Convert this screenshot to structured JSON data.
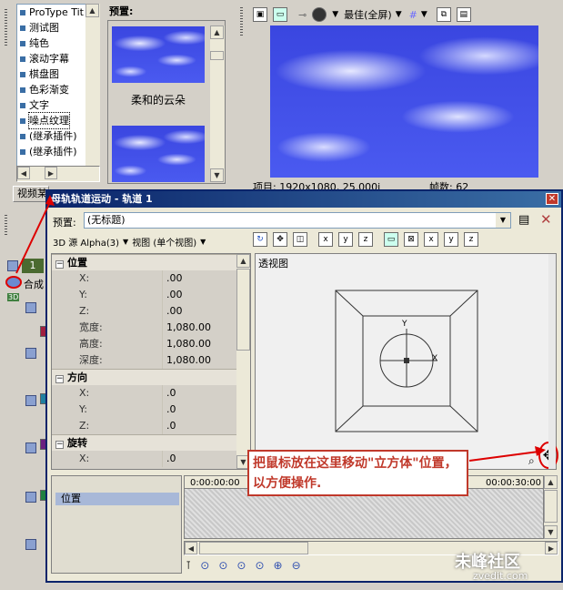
{
  "media_list": {
    "items": [
      "ProType Tit",
      "测试图",
      "纯色",
      "滚动字幕",
      "棋盘图",
      "色彩渐变",
      "文字",
      "噪点纹理",
      "(继承插件)",
      "(继承插件)"
    ],
    "selected_index": 7
  },
  "presets": {
    "label": "预置:",
    "items": [
      "柔和的云朵"
    ]
  },
  "viewer": {
    "quality": "最佳(全屏)",
    "status_left": "项目: 1920x1080, 25.000i",
    "status_right": "帧数: 62"
  },
  "left_tab": "视频某",
  "track": {
    "number": "1",
    "label": "合成",
    "badge": "3D"
  },
  "dialog": {
    "title": "母轨轨道运动 - 轨道 1",
    "preset_label": "预置:",
    "preset_value": "(无标题)",
    "source_mode": "3D 源 Alpha(3)",
    "view_mode": "视图 (单个视图)",
    "groups": {
      "position": "位置",
      "orientation": "方向",
      "rotation": "旋转"
    },
    "position_props": [
      {
        "name": "X:",
        "value": ".00"
      },
      {
        "name": "Y:",
        "value": ".00"
      },
      {
        "name": "Z:",
        "value": ".00"
      },
      {
        "name": "宽度:",
        "value": "1,080.00"
      },
      {
        "name": "高度:",
        "value": "1,080.00"
      },
      {
        "name": "深度:",
        "value": "1,080.00"
      }
    ],
    "orientation_props": [
      {
        "name": "X:",
        "value": ".0"
      },
      {
        "name": "Y:",
        "value": ".0"
      },
      {
        "name": "Z:",
        "value": ".0"
      }
    ],
    "rotation_props": [
      {
        "name": "X:",
        "value": ".0"
      }
    ],
    "viewport_label": "透视图",
    "axis_y": "Y",
    "axis_x": "X",
    "timeline_start": "0:00:00:00",
    "timeline_end": "00:00:30:00",
    "timeline_track": "位置"
  },
  "annotation": "把鼠标放在这里移动\"立方体\"位置，以方便操作.",
  "watermark": "未峰社区",
  "watermark_url": "zvedit.com",
  "colors": {
    "title_bar": "#0a246a",
    "callout": "#c0392b",
    "sky": "#3a46e0"
  }
}
